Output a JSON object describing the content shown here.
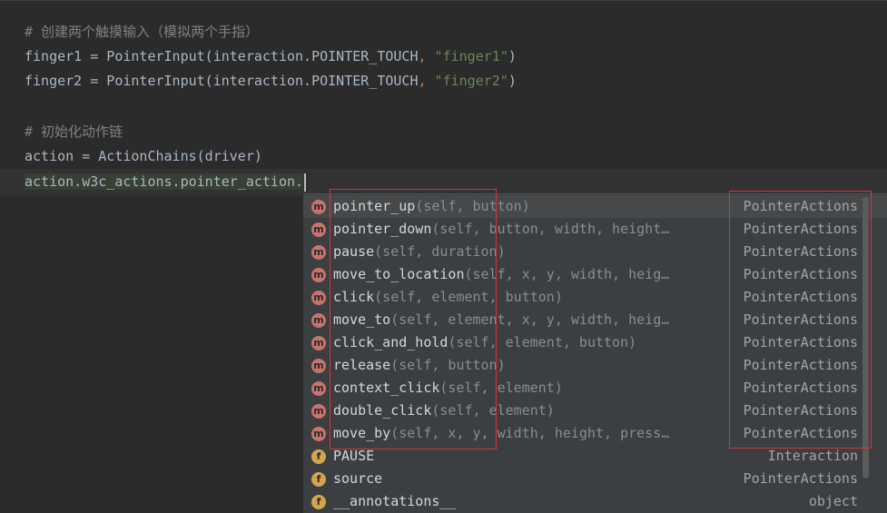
{
  "editor": {
    "lines": [
      {
        "kind": "comment",
        "text": "# 创建两个触摸输入（模拟两个手指）"
      },
      {
        "kind": "code",
        "pre": "finger1 = PointerInput(interaction.POINTER_TOUCH",
        "comma": ",",
        "post": " ",
        "str": "\"finger1\"",
        "end": ")"
      },
      {
        "kind": "code",
        "pre": "finger2 = PointerInput(interaction.POINTER_TOUCH",
        "comma": ",",
        "post": " ",
        "str": "\"finger2\"",
        "end": ")"
      },
      {
        "kind": "comment",
        "text": "# 初始化动作链"
      },
      {
        "kind": "plain",
        "text": "action = ActionChains(driver)"
      },
      {
        "kind": "current",
        "text": "action.w3c_actions.pointer_action."
      }
    ]
  },
  "completion": {
    "items": [
      {
        "icon": "m",
        "name": "pointer_up",
        "params": "(self, button)",
        "type": "PointerActions"
      },
      {
        "icon": "m",
        "name": "pointer_down",
        "params": "(self, button, width, height…",
        "type": "PointerActions"
      },
      {
        "icon": "m",
        "name": "pause",
        "params": "(self, duration)",
        "type": "PointerActions"
      },
      {
        "icon": "m",
        "name": "move_to_location",
        "params": "(self, x, y, width, heig…",
        "type": "PointerActions"
      },
      {
        "icon": "m",
        "name": "click",
        "params": "(self, element, button)",
        "type": "PointerActions"
      },
      {
        "icon": "m",
        "name": "move_to",
        "params": "(self, element, x, y, width, heig…",
        "type": "PointerActions"
      },
      {
        "icon": "m",
        "name": "click_and_hold",
        "params": "(self, element, button)",
        "type": "PointerActions"
      },
      {
        "icon": "m",
        "name": "release",
        "params": "(self, button)",
        "type": "PointerActions"
      },
      {
        "icon": "m",
        "name": "context_click",
        "params": "(self, element)",
        "type": "PointerActions"
      },
      {
        "icon": "m",
        "name": "double_click",
        "params": "(self, element)",
        "type": "PointerActions"
      },
      {
        "icon": "m",
        "name": "move_by",
        "params": "(self, x, y, width, height, press…",
        "type": "PointerActions"
      },
      {
        "icon": "f",
        "name": "PAUSE",
        "params": "",
        "type": "Interaction"
      },
      {
        "icon": "f",
        "name": "source",
        "params": "",
        "type": "PointerActions"
      },
      {
        "icon": "f",
        "name": "__annotations__",
        "params": "",
        "type": "object"
      }
    ]
  },
  "colors": {
    "background": "#2b2b2b",
    "popup": "#3c3f41",
    "method_badge": "#c9736d",
    "field_badge": "#d6a44e",
    "annotation_box": "#d9343c",
    "string": "#6a8759",
    "comment": "#808080"
  }
}
